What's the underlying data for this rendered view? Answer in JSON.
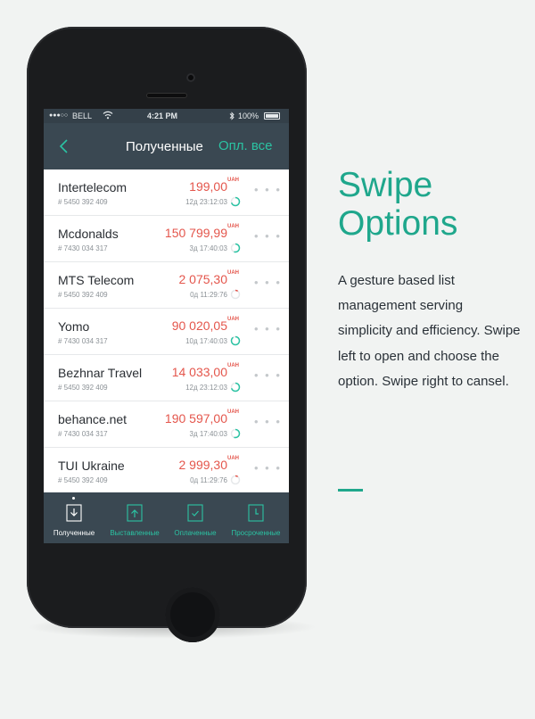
{
  "status_bar": {
    "signal": "●●●○○",
    "carrier": "BELL",
    "time": "4:21 PM",
    "battery": "100%"
  },
  "nav": {
    "title": "Полученные",
    "action": "Опл. все"
  },
  "colors": {
    "accent": "#2bc3a3",
    "amount": "#e4564c",
    "bar": "#3a4852"
  },
  "rows": [
    {
      "name": "Intertelecom",
      "account": "# 5450 392 409",
      "amount": "199,00",
      "currency": "UAH",
      "time": "12д 23:12:03",
      "status_progress": 0.7
    },
    {
      "name": "Mcdonalds",
      "account": "# 7430 034 317",
      "amount": "150 799,99",
      "currency": "UAH",
      "time": "3д 17:40:03",
      "status_progress": 0.55
    },
    {
      "name": "MTS Telecom",
      "account": "# 5450 392 409",
      "amount": "2 075,30",
      "currency": "UAH",
      "time": "0д 11:29:76",
      "status_progress": 0.1
    },
    {
      "name": "Yomo",
      "account": "# 7430 034 317",
      "amount": "90 020,05",
      "currency": "UAH",
      "time": "10д 17:40:03",
      "status_progress": 0.9
    },
    {
      "name": "Bezhnar Travel",
      "account": "# 5450 392 409",
      "amount": "14 033,00",
      "currency": "UAH",
      "time": "12д 23:12:03",
      "status_progress": 0.7
    },
    {
      "name": "behance.net",
      "account": "# 7430 034 317",
      "amount": "190 597,00",
      "currency": "UAH",
      "time": "3д 17:40:03",
      "status_progress": 0.55
    },
    {
      "name": "TUI Ukraine",
      "account": "# 5450 392 409",
      "amount": "2 999,30",
      "currency": "UAH",
      "time": "0д 11:29:76",
      "status_progress": 0.1
    }
  ],
  "more_glyph": "• • •",
  "tabs": [
    {
      "label": "Полученные",
      "icon": "inbox-download-icon",
      "active": true
    },
    {
      "label": "Выставленные",
      "icon": "outbox-upload-icon",
      "active": false
    },
    {
      "label": "Оплаченные",
      "icon": "paid-check-icon",
      "active": false
    },
    {
      "label": "Просроченные",
      "icon": "overdue-clock-icon",
      "active": false
    }
  ],
  "promo": {
    "title_line1": "Swipe",
    "title_line2": "Options",
    "body_lines": [
      "A gesture based list",
      "management serving",
      "simplicity and efficiency. Swipe",
      "left to open and choose the",
      "option. Swipe right to cansel."
    ]
  }
}
